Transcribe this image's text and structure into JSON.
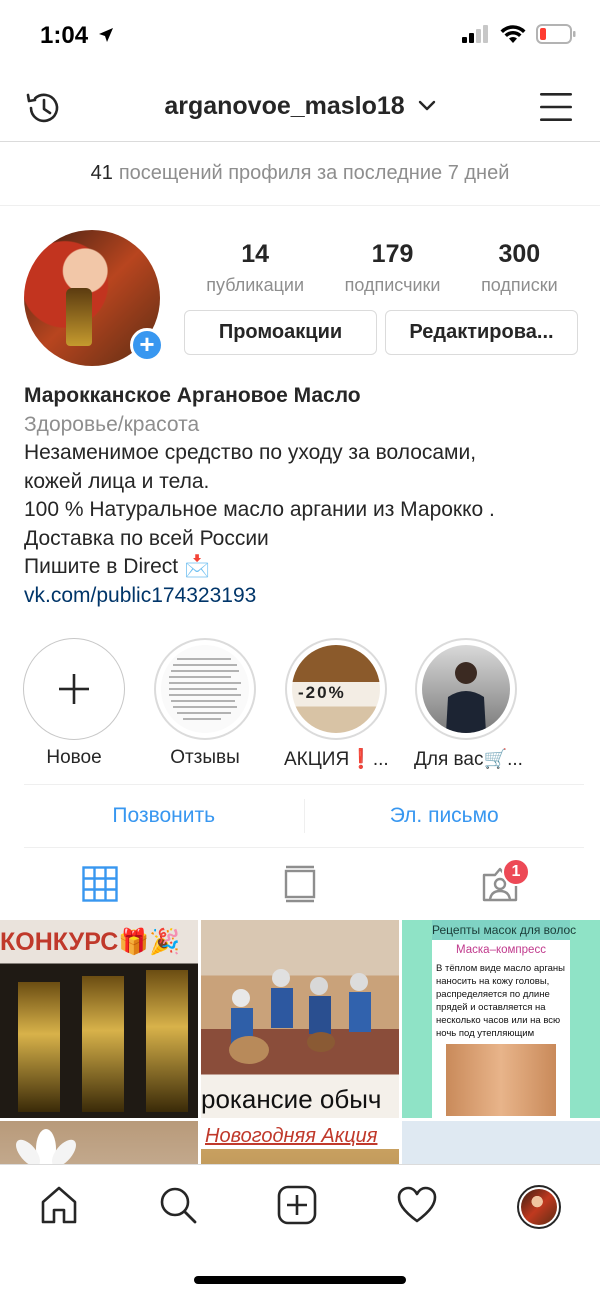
{
  "status": {
    "time": "1:04"
  },
  "nav": {
    "username": "arganovoe_maslo18"
  },
  "visits": {
    "count": "41",
    "text": "посещений профиля за последние 7 дней"
  },
  "profile": {
    "stats": [
      {
        "num": "14",
        "label": "публикации"
      },
      {
        "num": "179",
        "label": "подписчики"
      },
      {
        "num": "300",
        "label": "подписки"
      }
    ],
    "promo_button": "Промоакции",
    "edit_button": "Редактирова..."
  },
  "bio": {
    "name": "Марокканское Аргановое Масло",
    "category": "Здоровье/красота",
    "lines": [
      "Незаменимое средство по уходу за волосами,",
      "кожей лица и тела.",
      "100 % Натуральное масло аргании из Марокко .",
      "Доставка по всей России",
      "Пишите в Direct 📩"
    ],
    "link": "vk.com/public174323193"
  },
  "highlights": [
    {
      "label": "Новое"
    },
    {
      "label": "Отзывы"
    },
    {
      "label": "АКЦИЯ❗..."
    },
    {
      "label": "Для вас🛒..."
    }
  ],
  "highlight_texts": {
    "sale_badge": "-20%"
  },
  "contact": {
    "call": "Позвонить",
    "email": "Эл. письмо"
  },
  "tabs": {
    "tagged_badge": "1"
  },
  "grid": {
    "tile1_text": "КОНКУРС🎁🎉",
    "tile2_text": "рокансие обыч",
    "tile3_title": "Рецепты масок для волос",
    "tile3_subtitle": "Маска–компресс",
    "tile3_body": "В тёплом виде масло арганы наносить на кожу головы, распределяется по длине прядей и оставляется на несколько часов или на всю ночь под утепляющим компрессом.",
    "tile5_text": "Новогодняя Акция"
  },
  "colors": {
    "accent": "#3897f0",
    "badge": "#ed4956",
    "link": "#003569",
    "muted": "#8e8e8e",
    "text": "#262626"
  }
}
